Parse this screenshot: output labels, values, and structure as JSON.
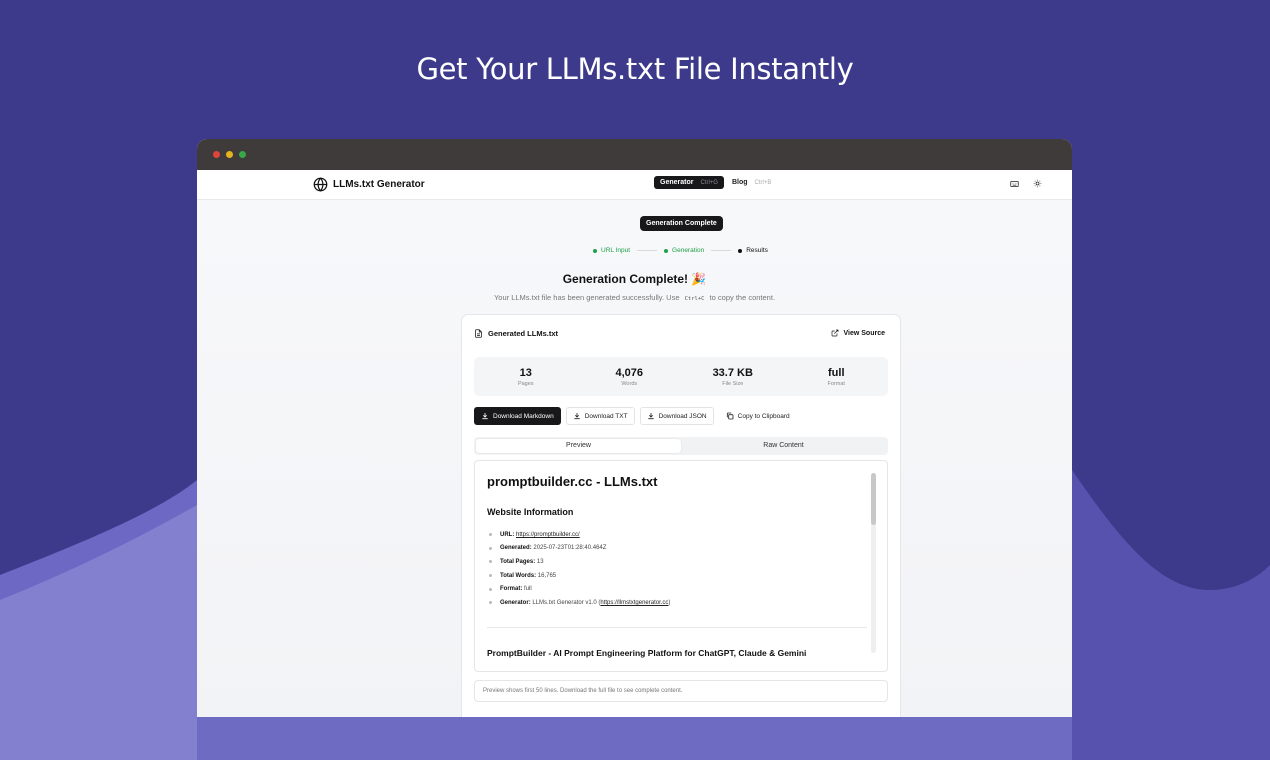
{
  "hero": {
    "title": "Get Your LLMs.txt File Instantly"
  },
  "colors": {
    "background": "#3d3a8c",
    "wave_light": "#8a86d4",
    "wave_mid": "#5752ae",
    "accent_green": "#21a04b",
    "dark": "#18181b"
  },
  "app": {
    "brand": "LLMs.txt Generator",
    "nav": {
      "generator_label": "Generator",
      "generator_shortcut": "Ctrl+G",
      "blog_label": "Blog",
      "blog_shortcut": "Ctrl+B"
    },
    "icons": {
      "keyboard": "keyboard-icon",
      "theme": "sun-icon",
      "brand": "globe-icon"
    }
  },
  "status": {
    "pill": "Generation Complete"
  },
  "stepper": {
    "steps": [
      {
        "label": "URL Input",
        "state": "done"
      },
      {
        "label": "Generation",
        "state": "done"
      },
      {
        "label": "Results",
        "state": "current"
      }
    ]
  },
  "result": {
    "title": "Generation Complete! 🎉",
    "subtitle_before": "Your LLMs.txt file has been generated successfully. Use",
    "subtitle_kbd": "Ctrl+C",
    "subtitle_after": "to copy the content."
  },
  "card": {
    "title": "Generated LLMs.txt",
    "view_source": "View Source",
    "stats": [
      {
        "value": "13",
        "label": "Pages"
      },
      {
        "value": "4,076",
        "label": "Words"
      },
      {
        "value": "33.7 KB",
        "label": "File Size"
      },
      {
        "value": "full",
        "label": "Format"
      }
    ],
    "actions": {
      "download_markdown": "Download Markdown",
      "download_txt": "Download TXT",
      "download_json": "Download JSON",
      "copy_clipboard": "Copy to Clipboard"
    },
    "tabs": {
      "preview": "Preview",
      "raw": "Raw Content"
    },
    "preview": {
      "h1": "promptbuilder.cc - LLMs.txt",
      "h2": "Website Information",
      "items": [
        {
          "key": "URL",
          "value": "",
          "link": "https://promptbuilder.cc/",
          "suffix": ""
        },
        {
          "key": "Generated",
          "value": "2025-07-23T01:28:40.464Z",
          "link": "",
          "suffix": ""
        },
        {
          "key": "Total Pages",
          "value": "13",
          "link": "",
          "suffix": ""
        },
        {
          "key": "Total Words",
          "value": "16,765",
          "link": "",
          "suffix": ""
        },
        {
          "key": "Format",
          "value": "full",
          "link": "",
          "suffix": ""
        },
        {
          "key": "Generator",
          "value": "LLMs.txt Generator v1.0 (",
          "link": "https://llmstxtgenerator.cc",
          "suffix": ")"
        }
      ],
      "h3": "PromptBuilder - AI Prompt Engineering Platform for ChatGPT, Claude & Gemini"
    },
    "notice": "Preview shows first 50 lines. Download the full file to see complete content."
  }
}
